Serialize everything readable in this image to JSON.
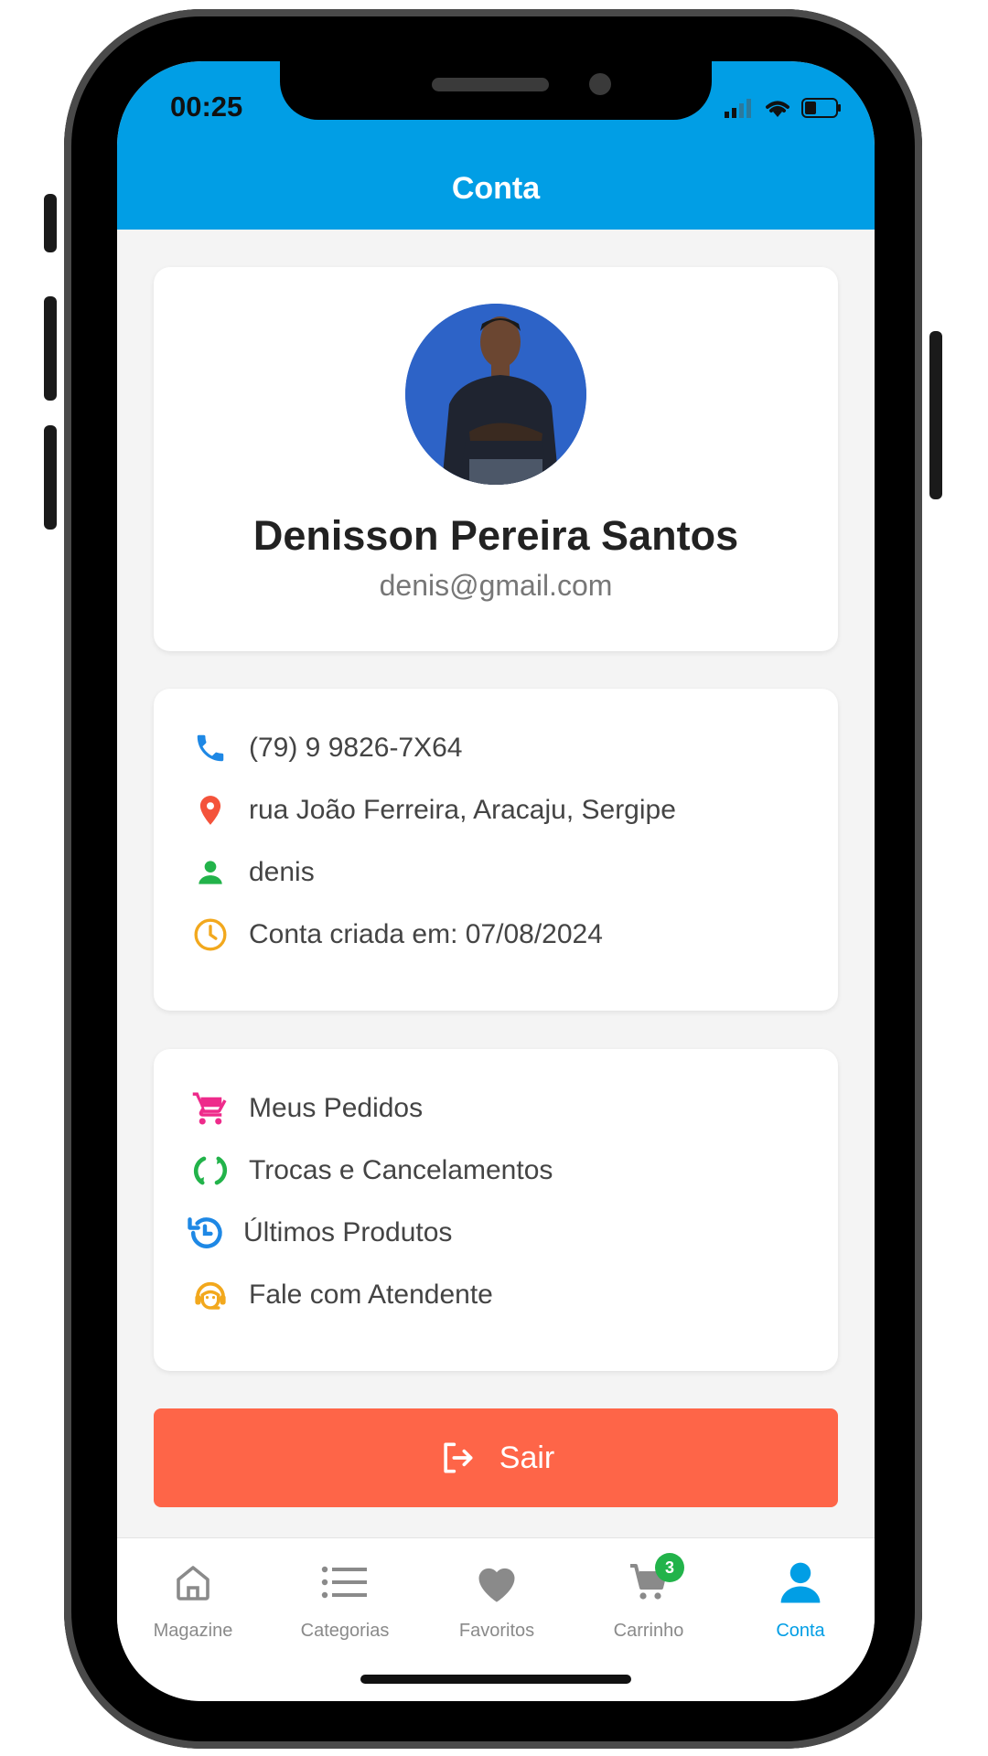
{
  "status_bar": {
    "time": "00:25"
  },
  "header": {
    "title": "Conta"
  },
  "profile": {
    "name": "Denisson Pereira Santos",
    "email": "denis@gmail.com"
  },
  "info": {
    "items": [
      {
        "icon": "phone-icon",
        "color": "#1e88e5",
        "text": "(79) 9 9826-7X64"
      },
      {
        "icon": "location-pin-icon",
        "color": "#f4533b",
        "text": "rua João Ferreira, Aracaju, Sergipe"
      },
      {
        "icon": "person-icon",
        "color": "#22b34a",
        "text": "denis"
      },
      {
        "icon": "clock-icon",
        "color": "#f2a81d",
        "text": "Conta criada em: 07/08/2024"
      }
    ]
  },
  "menu": {
    "items": [
      {
        "icon": "cart-icon",
        "color": "#ee2b8b",
        "text": "Meus Pedidos"
      },
      {
        "icon": "refresh-icon",
        "color": "#22b34a",
        "text": "Trocas e Cancelamentos"
      },
      {
        "icon": "history-icon",
        "color": "#1e88e5",
        "text": "Últimos Produtos"
      },
      {
        "icon": "support-agent-icon",
        "color": "#f2a81d",
        "text": "Fale com Atendente"
      }
    ]
  },
  "logout": {
    "label": "Sair"
  },
  "tabbar": {
    "tabs": [
      {
        "label": "Magazine",
        "icon": "home-icon"
      },
      {
        "label": "Categorias",
        "icon": "list-icon"
      },
      {
        "label": "Favoritos",
        "icon": "heart-icon"
      },
      {
        "label": "Carrinho",
        "icon": "cart-icon",
        "badge": "3"
      },
      {
        "label": "Conta",
        "icon": "user-icon",
        "active": true
      }
    ]
  },
  "colors": {
    "primary": "#019ee5",
    "logout": "#fe6548",
    "badge": "#22b34a"
  }
}
